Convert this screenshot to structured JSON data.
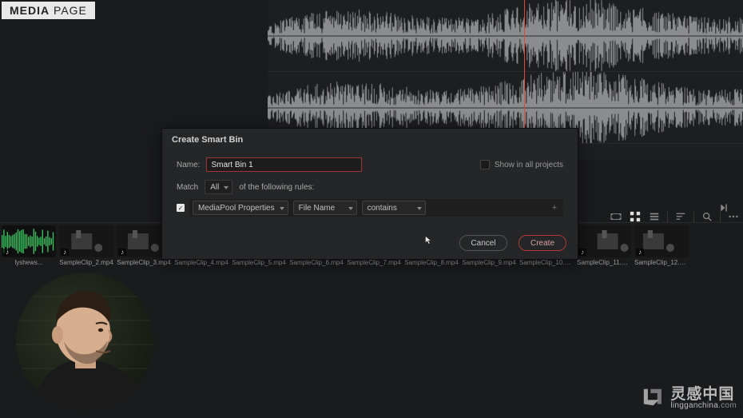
{
  "header": {
    "label_bold": "MEDIA",
    "label_rest": " PAGE"
  },
  "dialog": {
    "title": "Create Smart Bin",
    "name_label": "Name:",
    "name_value": "Smart Bin 1",
    "show_all_label": "Show in all projects",
    "match_label": "Match",
    "match_value": "All",
    "match_suffix": "of the following rules:",
    "rule": {
      "source": "MediaPool Properties",
      "field": "File Name",
      "op": "contains"
    },
    "cancel": "Cancel",
    "create": "Create"
  },
  "clips": [
    {
      "name": "lyshews...",
      "variant": "audio"
    },
    {
      "name": "SampleClip_2.mp4",
      "variant": "dark1"
    },
    {
      "name": "SampleClip_3.mp4",
      "variant": "dark2"
    },
    {
      "name": "SampleClip_4.mp4",
      "variant": "dark2"
    },
    {
      "name": "SampleClip_5.mp4",
      "variant": "dark2"
    },
    {
      "name": "SampleClip_6.mp4",
      "variant": "dark2"
    },
    {
      "name": "SampleClip_7.mp4",
      "variant": "dark2"
    },
    {
      "name": "SampleClip_8.mp4",
      "variant": "orange"
    },
    {
      "name": "SampleClip_9.mp4",
      "variant": "people"
    },
    {
      "name": "SampleClip_10.mp4",
      "variant": "dark3"
    },
    {
      "name": "SampleClip_11.mp4",
      "variant": "dark1"
    },
    {
      "name": "SampleClip_12.mp4",
      "variant": "dark2"
    }
  ],
  "toolbar": {
    "icons": [
      "film-strip-icon",
      "grid-icon",
      "list-icon",
      "separator",
      "sort-icon",
      "separator",
      "search-icon",
      "separator",
      "options-icon"
    ]
  },
  "watermark": {
    "cn": "灵感中国",
    "en_a": "lingganchina",
    "en_b": ".com"
  }
}
